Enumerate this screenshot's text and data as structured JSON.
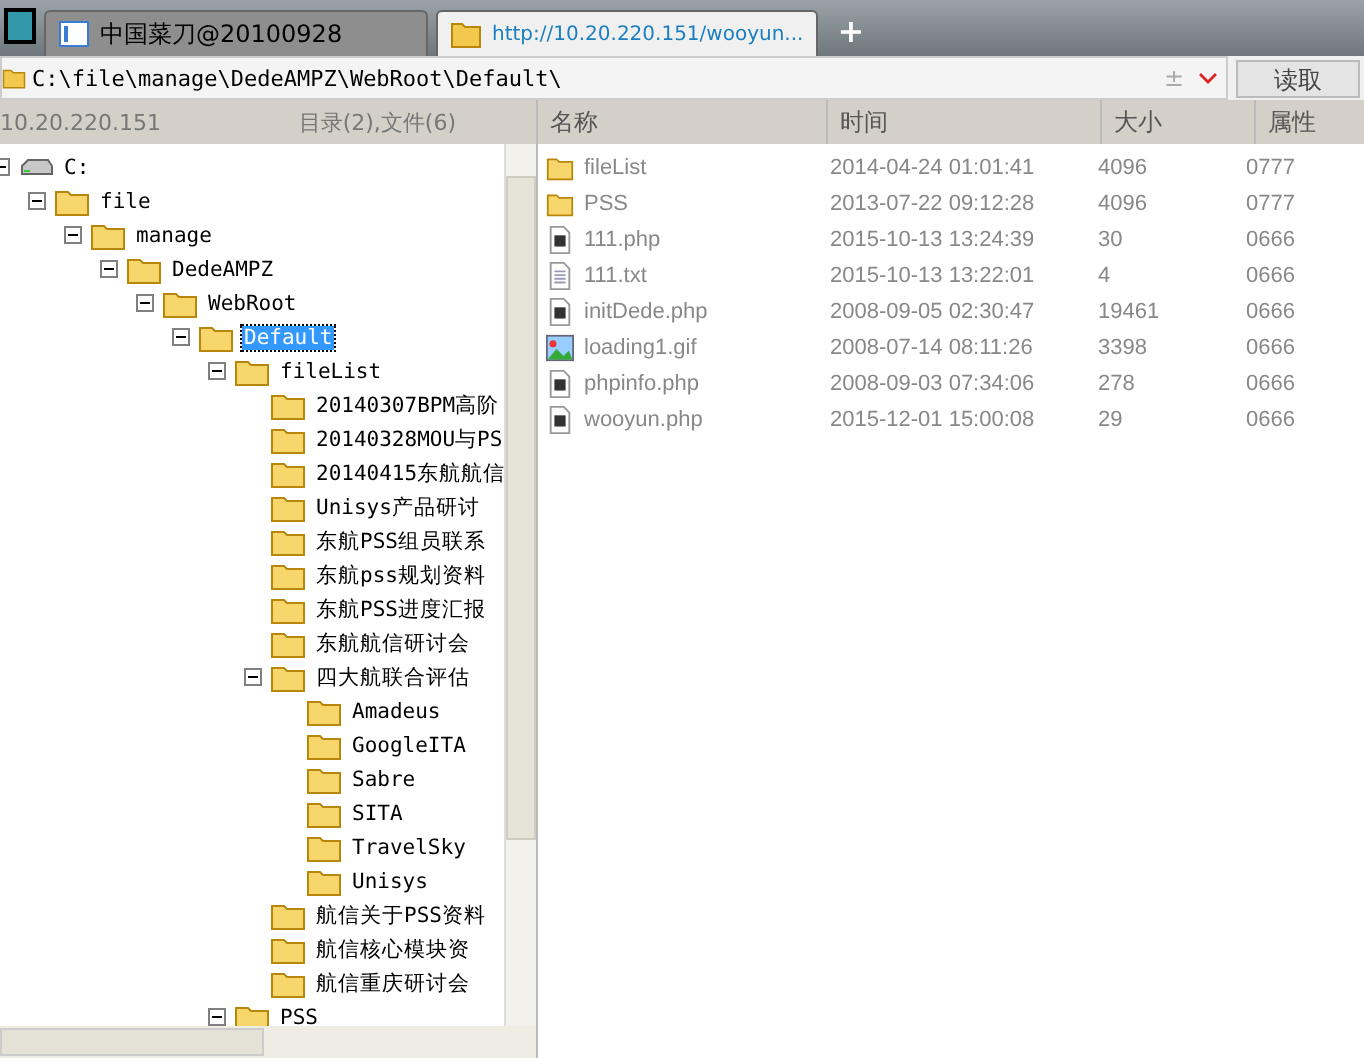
{
  "tabs": [
    {
      "label": "中国菜刀@20100928",
      "kind": "app",
      "selected": false
    },
    {
      "label": "http://10.20.220.151/wooyun...",
      "kind": "folder",
      "selected": true
    }
  ],
  "new_tab": "+",
  "address": {
    "value": "C:\\file\\manage\\DedeAMPZ\\WebRoot\\Default\\",
    "plusminus": "±",
    "read_button": "读取"
  },
  "left_header": {
    "host": "10.20.220.151",
    "summary": "目录(2),文件(6)"
  },
  "tree": [
    {
      "label": "C:",
      "kind": "drive",
      "selected": false,
      "expanded": true,
      "children": [
        {
          "label": "file",
          "kind": "folder",
          "selected": false,
          "expanded": true,
          "children": [
            {
              "label": "manage",
              "kind": "folder",
              "selected": false,
              "expanded": true,
              "children": [
                {
                  "label": "DedeAMPZ",
                  "kind": "folder",
                  "selected": false,
                  "expanded": true,
                  "children": [
                    {
                      "label": "WebRoot",
                      "kind": "folder",
                      "selected": false,
                      "expanded": true,
                      "children": [
                        {
                          "label": "Default",
                          "kind": "folder",
                          "selected": true,
                          "expanded": true,
                          "children": [
                            {
                              "label": "fileList",
                              "kind": "folder",
                              "selected": false,
                              "expanded": true,
                              "children": [
                                {
                                  "label": "20140307BPM高阶",
                                  "kind": "folder",
                                  "selected": false
                                },
                                {
                                  "label": "20140328MOU与PS",
                                  "kind": "folder",
                                  "selected": false
                                },
                                {
                                  "label": "20140415东航航信",
                                  "kind": "folder",
                                  "selected": false
                                },
                                {
                                  "label": "Unisys产品研讨",
                                  "kind": "folder",
                                  "selected": false
                                },
                                {
                                  "label": "东航PSS组员联系",
                                  "kind": "folder",
                                  "selected": false
                                },
                                {
                                  "label": "东航pss规划资料",
                                  "kind": "folder",
                                  "selected": false
                                },
                                {
                                  "label": "东航PSS进度汇报",
                                  "kind": "folder",
                                  "selected": false
                                },
                                {
                                  "label": "东航航信研讨会",
                                  "kind": "folder",
                                  "selected": false
                                },
                                {
                                  "label": "四大航联合评估",
                                  "kind": "folder",
                                  "selected": false,
                                  "expanded": true,
                                  "children": [
                                    {
                                      "label": "Amadeus",
                                      "kind": "folder",
                                      "selected": false
                                    },
                                    {
                                      "label": "GoogleITA",
                                      "kind": "folder",
                                      "selected": false
                                    },
                                    {
                                      "label": "Sabre",
                                      "kind": "folder",
                                      "selected": false
                                    },
                                    {
                                      "label": "SITA",
                                      "kind": "folder",
                                      "selected": false
                                    },
                                    {
                                      "label": "TravelSky",
                                      "kind": "folder",
                                      "selected": false
                                    },
                                    {
                                      "label": "Unisys",
                                      "kind": "folder",
                                      "selected": false
                                    }
                                  ]
                                },
                                {
                                  "label": "航信关于PSS资料",
                                  "kind": "folder",
                                  "selected": false
                                },
                                {
                                  "label": "航信核心模块资",
                                  "kind": "folder",
                                  "selected": false
                                },
                                {
                                  "label": "航信重庆研讨会",
                                  "kind": "folder",
                                  "selected": false
                                }
                              ]
                            },
                            {
                              "label": "PSS",
                              "kind": "folder",
                              "selected": false,
                              "expanded": true
                            }
                          ]
                        }
                      ]
                    }
                  ]
                }
              ]
            }
          ]
        }
      ]
    }
  ],
  "table": {
    "columns": [
      "名称",
      "时间",
      "大小",
      "属性"
    ],
    "rows": [
      {
        "kind": "folder",
        "name": "fileList",
        "time": "2014-04-24 01:01:41",
        "size": "4096",
        "attr": "0777"
      },
      {
        "kind": "folder",
        "name": "PSS",
        "time": "2013-07-22 09:12:28",
        "size": "4096",
        "attr": "0777"
      },
      {
        "kind": "php",
        "name": "111.php",
        "time": "2015-10-13 13:24:39",
        "size": "30",
        "attr": "0666"
      },
      {
        "kind": "txt",
        "name": "111.txt",
        "time": "2015-10-13 13:22:01",
        "size": "4",
        "attr": "0666"
      },
      {
        "kind": "php",
        "name": "initDede.php",
        "time": "2008-09-05 02:30:47",
        "size": "19461",
        "attr": "0666"
      },
      {
        "kind": "gif",
        "name": "loading1.gif",
        "time": "2008-07-14 08:11:26",
        "size": "3398",
        "attr": "0666"
      },
      {
        "kind": "php",
        "name": "phpinfo.php",
        "time": "2008-09-03 07:34:06",
        "size": "278",
        "attr": "0666"
      },
      {
        "kind": "php",
        "name": "wooyun.php",
        "time": "2015-12-01 15:00:08",
        "size": "29",
        "attr": "0666"
      }
    ]
  }
}
